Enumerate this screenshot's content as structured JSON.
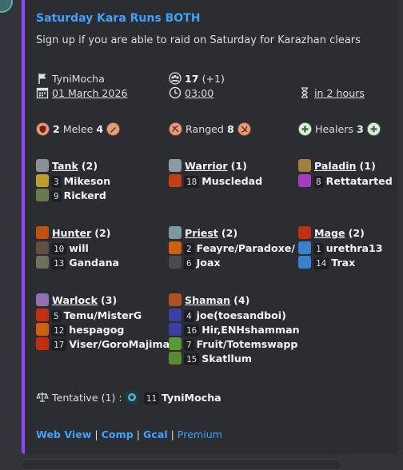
{
  "embed": {
    "title": "Saturday Kara Runs BOTH",
    "description": "Sign up if you are able to raid on Saturday for Karazhan clears",
    "leader": "TyniMocha",
    "date": "01 March 2026",
    "signups": "17",
    "signups_extra": "(+1)",
    "time": "03:00",
    "countdown": "in 2 hours",
    "melee_label": "Melee",
    "melee_count": "2",
    "melee_count2": "4",
    "ranged_label": "Ranged",
    "ranged_count": "8",
    "healers_label": "Healers",
    "healers_count": "3",
    "classes": {
      "tank": {
        "name": "Tank",
        "count": "(2)",
        "members": [
          {
            "n": "3",
            "name": "Mikeson"
          },
          {
            "n": "9",
            "name": "Rickerd"
          }
        ]
      },
      "warrior": {
        "name": "Warrior",
        "count": "(1)",
        "members": [
          {
            "n": "18",
            "name": "Muscledad"
          }
        ]
      },
      "paladin": {
        "name": "Paladin",
        "count": "(1)",
        "members": [
          {
            "n": "8",
            "name": "Rettatarted"
          }
        ]
      },
      "hunter": {
        "name": "Hunter",
        "count": "(2)",
        "members": [
          {
            "n": "10",
            "name": "will"
          },
          {
            "n": "13",
            "name": "Gandana"
          }
        ]
      },
      "priest": {
        "name": "Priest",
        "count": "(2)",
        "members": [
          {
            "n": "2",
            "name": "Feayre/Paradoxe/"
          },
          {
            "n": "6",
            "name": "Joax"
          }
        ]
      },
      "mage": {
        "name": "Mage",
        "count": "(2)",
        "members": [
          {
            "n": "1",
            "name": "urethra13"
          },
          {
            "n": "14",
            "name": "Trax"
          }
        ]
      },
      "warlock": {
        "name": "Warlock",
        "count": "(3)",
        "members": [
          {
            "n": "5",
            "name": "Temu/MisterG"
          },
          {
            "n": "12",
            "name": "hespagog"
          },
          {
            "n": "17",
            "name": "Viser/GoroMajima"
          }
        ]
      },
      "shaman": {
        "name": "Shaman",
        "count": "(4)",
        "members": [
          {
            "n": "4",
            "name": "joe(toesandboi)"
          },
          {
            "n": "16",
            "name": "Hir,ENHshamman"
          },
          {
            "n": "7",
            "name": "Fruit/Totemswapp"
          },
          {
            "n": "15",
            "name": "Skatllum"
          }
        ]
      }
    },
    "tentative_label": "Tentative (1) :",
    "tentative_num": "11",
    "tentative_name": "TyniMocha",
    "links": {
      "web": "Web View",
      "comp": "Comp",
      "gcal": "Gcal",
      "premium": "Premium",
      "sep": "|"
    }
  },
  "colors": {
    "accent": "#9146ff",
    "link": "#3ea1ff"
  }
}
